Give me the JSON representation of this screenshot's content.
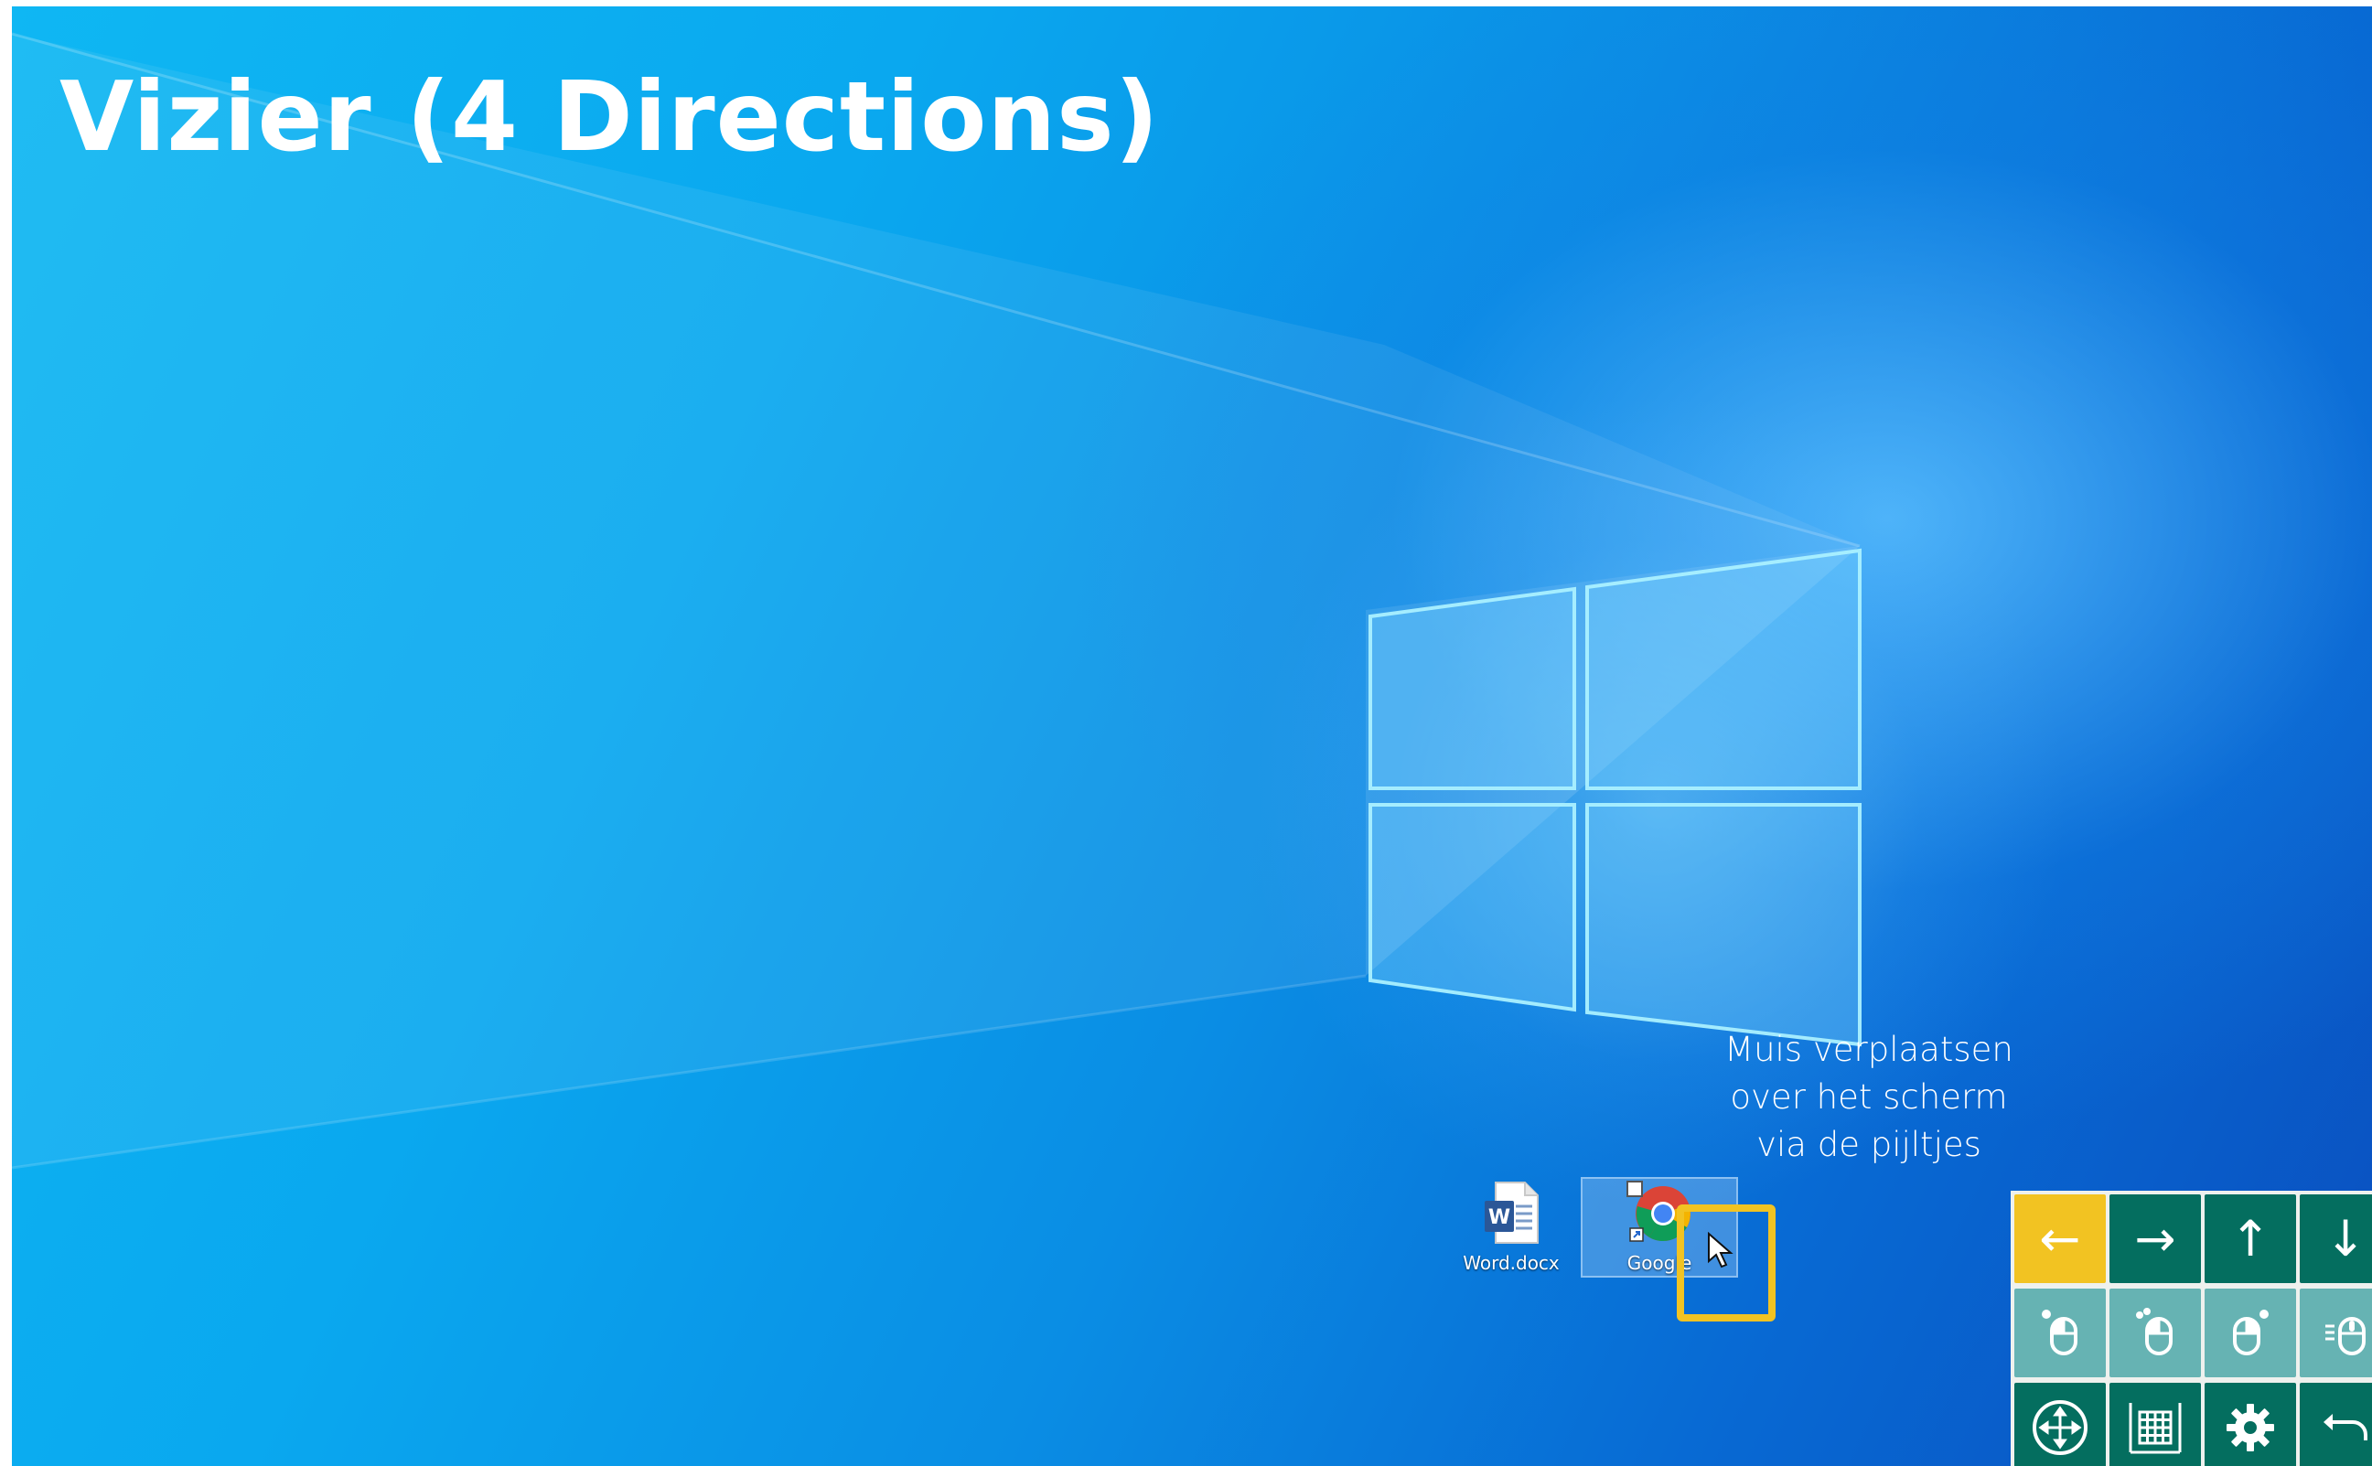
{
  "page": {
    "title": "Vizier (4 Directions)"
  },
  "hint": {
    "lines": [
      "Muis verplaatsen",
      "over het scherm",
      "via de pijltjes"
    ]
  },
  "desktop_icons": [
    {
      "label": "Word.docx",
      "icon": "word-document-icon"
    },
    {
      "label": "Google",
      "icon": "chrome-icon"
    }
  ],
  "vizier_panel": {
    "rows": [
      [
        {
          "glyph": "←",
          "icon": "arrow-left-icon",
          "active": true
        },
        {
          "glyph": "→",
          "icon": "arrow-right-icon",
          "active": false
        },
        {
          "glyph": "↑",
          "icon": "arrow-up-icon",
          "active": false
        },
        {
          "glyph": "↓",
          "icon": "arrow-down-icon",
          "active": false
        }
      ],
      [
        {
          "icon": "mouse-left-click-icon"
        },
        {
          "icon": "mouse-double-click-icon"
        },
        {
          "icon": "mouse-right-click-icon"
        },
        {
          "icon": "mouse-scroll-icon"
        }
      ],
      [
        {
          "icon": "move-all-directions-icon"
        },
        {
          "icon": "grid-keyboard-icon"
        },
        {
          "icon": "gear-icon"
        },
        {
          "icon": "undo-back-icon"
        }
      ]
    ]
  },
  "colors": {
    "accent_yellow": "#f2c322",
    "key_dark": "#046e5f",
    "key_light": "#66b3b3",
    "title_text": "#ffffff"
  }
}
